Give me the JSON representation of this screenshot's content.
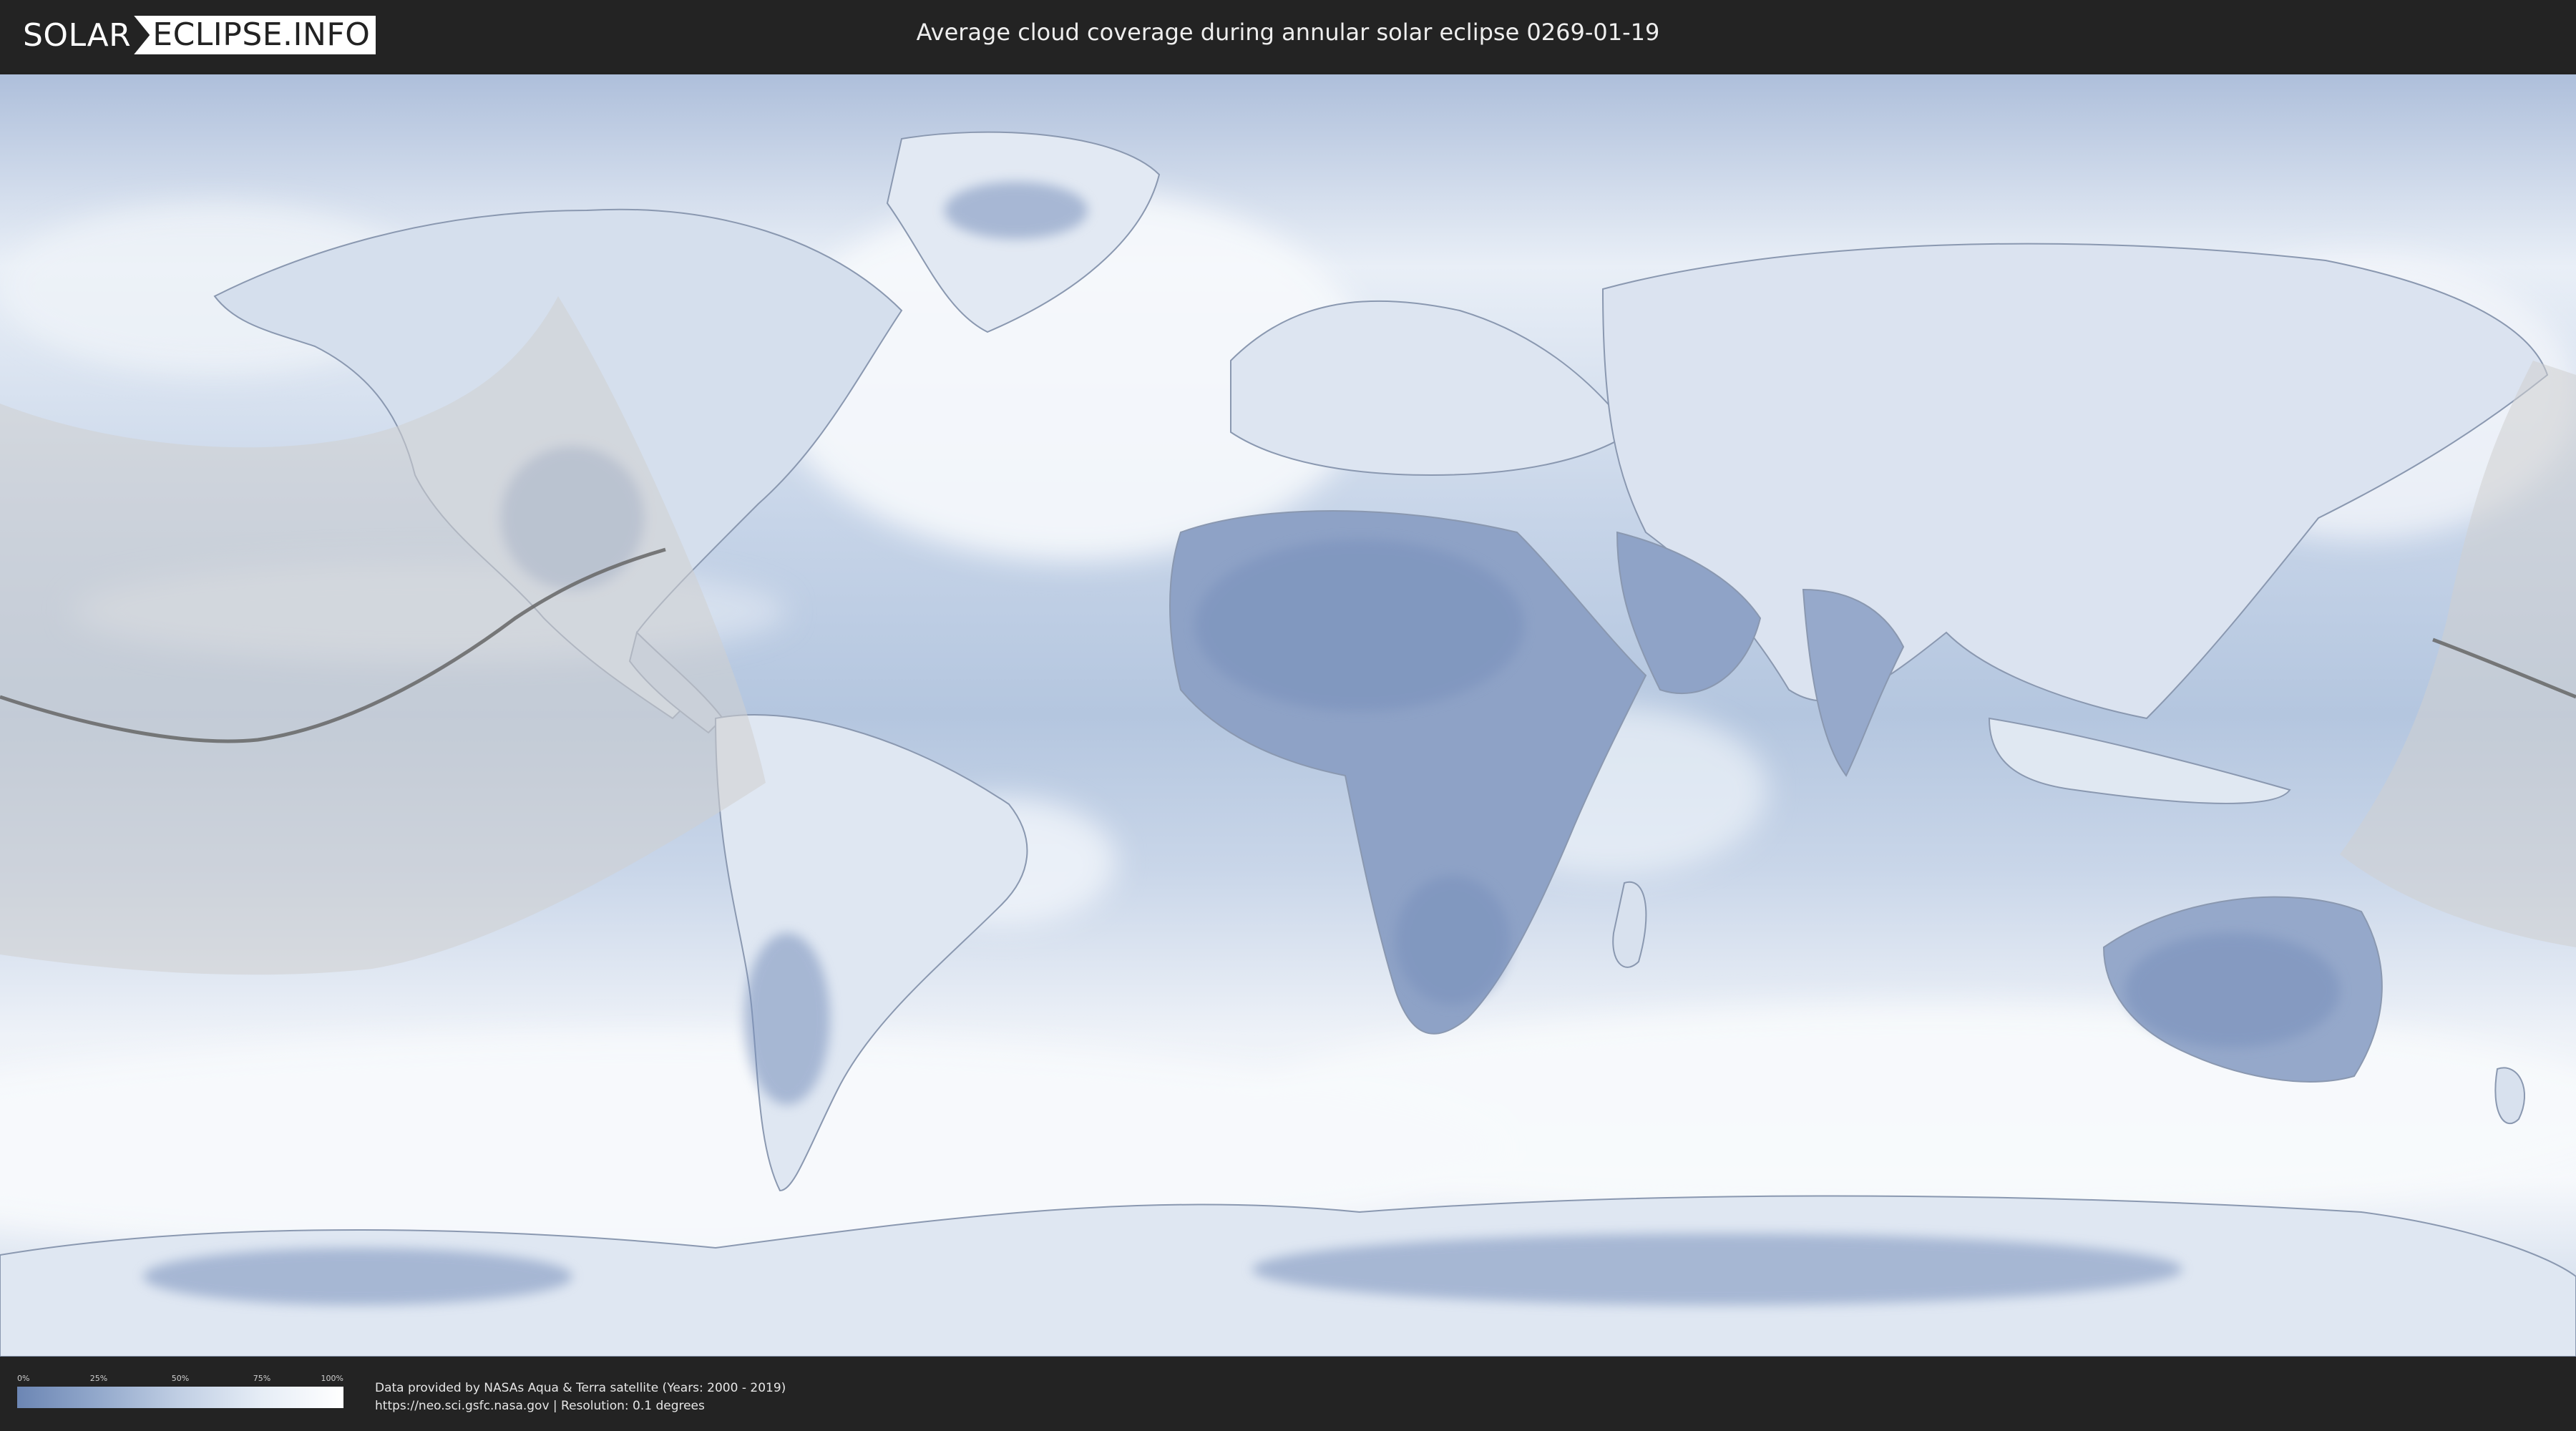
{
  "header": {
    "logo_left": "SOLAR",
    "logo_right": "ECLIPSE.INFO",
    "title": "Average cloud coverage during annular solar eclipse 0269-01-19"
  },
  "legend": {
    "ticks": [
      "0%",
      "25%",
      "50%",
      "75%",
      "100%"
    ],
    "colors": [
      "#6c86b4",
      "#93a9cc",
      "#c1cfe4",
      "#e6edf6",
      "#ffffff"
    ]
  },
  "footer": {
    "credit_line1": "Data provided by NASAs Aqua & Terra satellite (Years: 2000 - 2019)",
    "credit_line2": "https://neo.sci.gsfc.nasa.gov | Resolution: 0.1 degrees"
  },
  "map": {
    "projection": "equirectangular",
    "ocean_color": "#b8c9e1",
    "cloud_color": "#f4f7fb",
    "land_dark_color": "#6f87b5",
    "eclipse_band_color": "#d2d2d2",
    "center_line_color": "#666666"
  }
}
